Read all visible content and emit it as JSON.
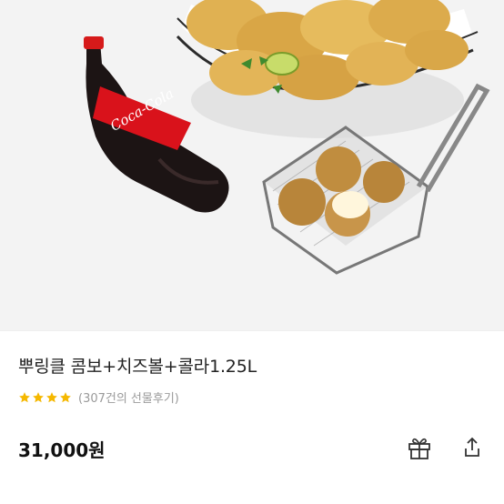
{
  "product": {
    "title": "뿌링클 콤보+치즈볼+콜라1.25L",
    "rating": 4,
    "rating_max": 5,
    "review_text": "(307건의 선물후기)",
    "price": "31,000원",
    "bottle_label": "Coca-Cola"
  },
  "actions": {
    "gift_icon": "gift-icon",
    "share_icon": "share-icon"
  },
  "colors": {
    "star": "#f5b800",
    "hero_bg": "#f3f3f3",
    "text": "#222222",
    "muted": "#9a9a9a"
  }
}
